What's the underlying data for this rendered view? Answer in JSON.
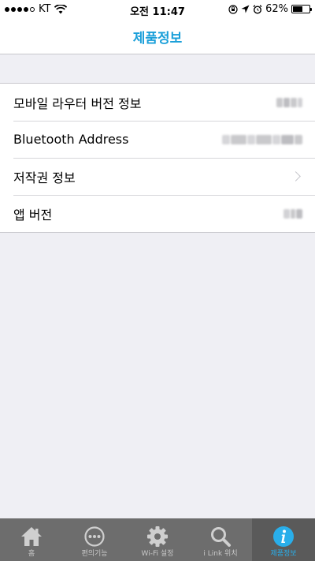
{
  "status_bar": {
    "carrier": "KT",
    "time": "오전 11:47",
    "battery": "62%",
    "battery_level": 0.62
  },
  "nav": {
    "title": "제품정보"
  },
  "rows": [
    {
      "label": "모바일 라우터 버전 정보"
    },
    {
      "label": "Bluetooth Address"
    },
    {
      "label": "저작권 정보"
    },
    {
      "label": "앱 버전"
    }
  ],
  "tabs": [
    {
      "label": "홈",
      "icon": "home-icon"
    },
    {
      "label": "편의기능",
      "icon": "more-dots-icon"
    },
    {
      "label": "Wi-Fi 설정",
      "icon": "gear-icon"
    },
    {
      "label": "i Link 위치",
      "icon": "search-icon"
    },
    {
      "label": "제품정보",
      "icon": "info-icon",
      "active": true
    }
  ],
  "colors": {
    "accent": "#1a9fd9",
    "tab_active": "#29aeea",
    "tab_bar": "#6d6d6d"
  }
}
